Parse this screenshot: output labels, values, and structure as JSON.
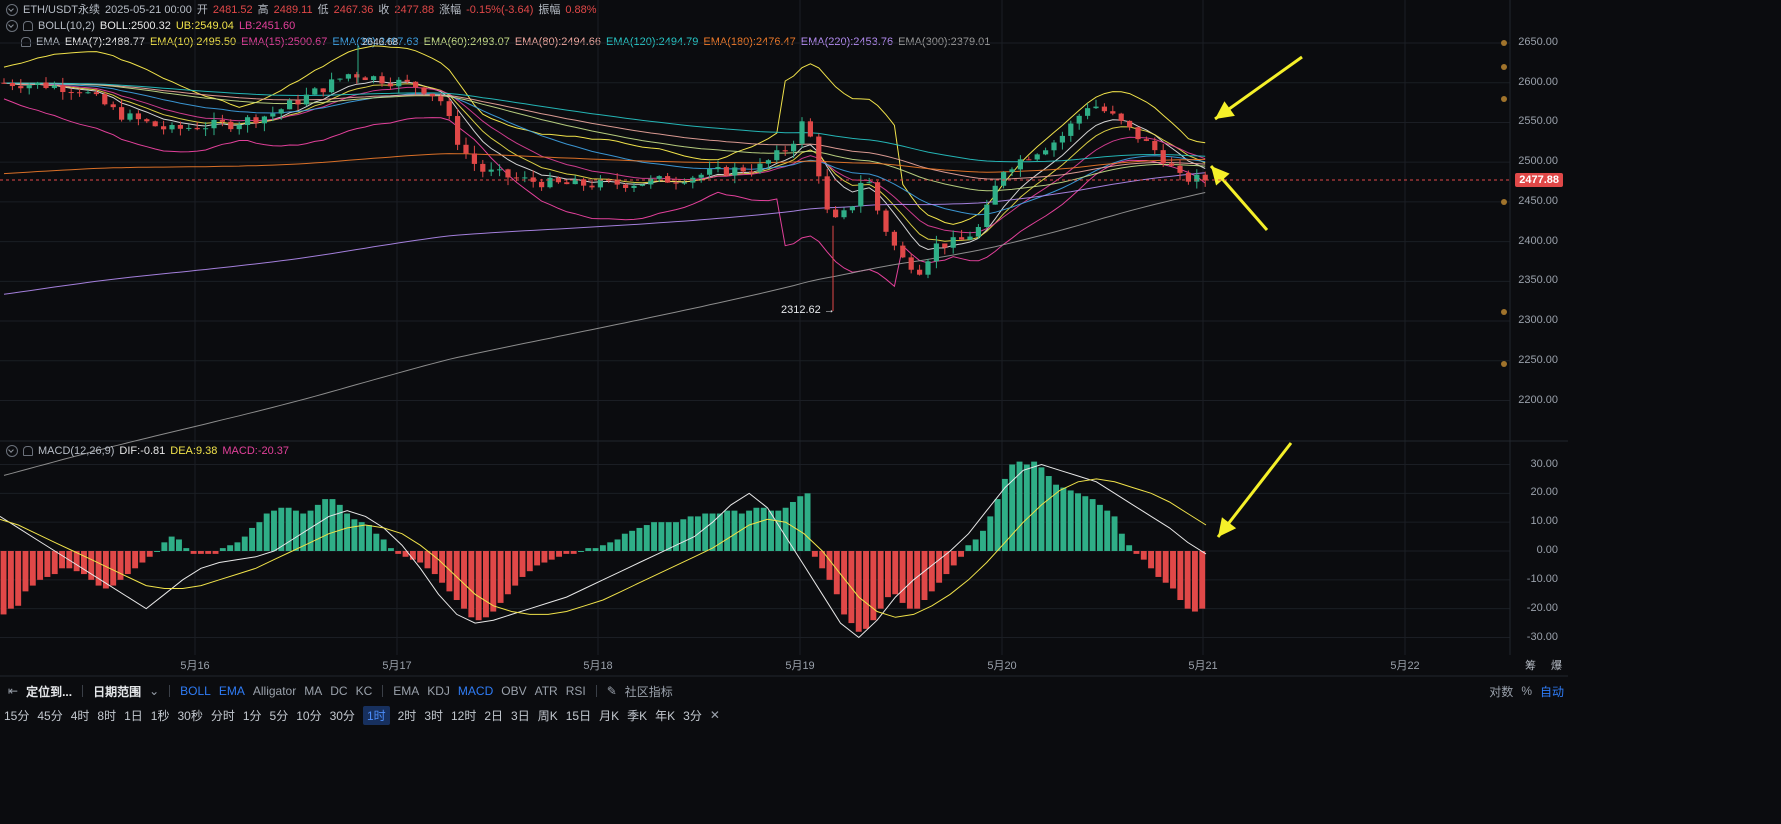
{
  "header": {
    "symbol": "ETH/USDT永续",
    "datetime": "2025-05-21 00:00",
    "open_label": "开",
    "open": "2481.52",
    "high_label": "高",
    "high": "2489.11",
    "low_label": "低",
    "low": "2467.36",
    "close_label": "收",
    "close": "2477.88",
    "change_label": "涨幅",
    "change": "-0.15%(-3.64)",
    "amp_label": "振幅",
    "amp": "0.88%"
  },
  "boll": {
    "name": "BOLL(10,2)",
    "mid": "BOLL:2500.32",
    "ub": "UB:2549.04",
    "lb": "LB:2451.60"
  },
  "ema": {
    "name": "EMA",
    "items": [
      {
        "text": "EMA(7):2488.77",
        "color": "#e8e8e8"
      },
      {
        "text": "EMA(10):2495.50",
        "color": "#f0e24a"
      },
      {
        "text": "EMA(15):2500.67",
        "color": "#e2409a"
      },
      {
        "text": "EMA(30):2497.63",
        "color": "#3fa3e6"
      },
      {
        "text": "EMA(60):2493.07",
        "color": "#c8e08a"
      },
      {
        "text": "EMA(80):2494.66",
        "color": "#f0a8a0"
      },
      {
        "text": "EMA(120):2494.79",
        "color": "#27c6c6"
      },
      {
        "text": "EMA(180):2476.47",
        "color": "#f07a2a"
      },
      {
        "text": "EMA(220):2453.76",
        "color": "#b48cf2"
      },
      {
        "text": "EMA(300):2379.01",
        "color": "#9a9a9a"
      }
    ]
  },
  "macd": {
    "name": "MACD(12,26,9)",
    "dif": "DIF:-0.81",
    "dea": "DEA:9.38",
    "macd": "MACD:-20.37"
  },
  "annotations": {
    "high_label": "2646.68",
    "low_label": "2312.62 →"
  },
  "current_price": "2477.88",
  "toolbar": {
    "locate": "定位到...",
    "date_range": "日期范围",
    "main_indicators": [
      "BOLL",
      "EMA",
      "Alligator",
      "MA",
      "DC",
      "KC"
    ],
    "sub_indicators": [
      "EMA",
      "KDJ",
      "MACD",
      "OBV",
      "ATR",
      "RSI"
    ],
    "community": "社区指标",
    "right": [
      "对数",
      "%",
      "自动"
    ],
    "bottom_right": [
      "筹",
      "爆"
    ]
  },
  "timeframes": [
    "15分",
    "45分",
    "4时",
    "8时",
    "1日",
    "1秒",
    "30秒",
    "分时",
    "1分",
    "5分",
    "10分",
    "30分",
    "1时",
    "2时",
    "3时",
    "12时",
    "2日",
    "3日",
    "周K",
    "15日",
    "月K",
    "季K",
    "年K",
    "3分"
  ],
  "selected_timeframe": "1时",
  "colors": {
    "up": "#2fae87",
    "down": "#e04848",
    "bg": "#0b0c0f",
    "arrow": "#f5f029",
    "accent": "#2f7cf6"
  },
  "chart_data": [
    {
      "type": "candlestick",
      "x_ticks": [
        "5月16",
        "5月17",
        "5月18",
        "5月19",
        "5月20",
        "5月21",
        "5月22"
      ],
      "y_ticks": [
        2200,
        2250,
        2300,
        2350,
        2400,
        2450,
        2500,
        2550,
        2600,
        2650
      ],
      "ylim": [
        2165,
        2680
      ],
      "grid": true,
      "key_points": [
        {
          "label": "start",
          "value": 2600
        },
        {
          "label": "5月16",
          "value": 2545
        },
        {
          "label": "5月16 high",
          "value": 2646.68
        },
        {
          "label": "5月17 late",
          "value": 2470
        },
        {
          "label": "5月18",
          "value": 2478
        },
        {
          "label": "5月19 peak",
          "value": 2560
        },
        {
          "label": "5月19 low",
          "value": 2312.62
        },
        {
          "label": "5月19 late",
          "value": 2360
        },
        {
          "label": "5月20",
          "value": 2490
        },
        {
          "label": "5月20 high",
          "value": 2585
        },
        {
          "label": "last close",
          "value": 2477.88
        }
      ]
    },
    {
      "type": "bar",
      "title": "MACD(12,26,9)",
      "y_ticks": [
        -30,
        -20,
        -10,
        0,
        10,
        20,
        30
      ],
      "ylim": [
        -35,
        35
      ],
      "series": [
        {
          "name": "MACD",
          "values": [
            -22,
            -20,
            -19,
            -14,
            -12,
            -10,
            -9,
            -8,
            -6,
            -6,
            -7,
            -8,
            -10,
            -12,
            -13,
            -12,
            -10,
            -8,
            -6,
            -4,
            -2,
            0,
            3,
            5,
            4,
            1,
            -1,
            -1,
            -1,
            -1,
            1,
            2,
            3,
            5,
            8,
            10,
            13,
            14,
            15,
            15,
            14,
            13,
            14,
            16,
            18,
            18,
            16,
            13,
            11,
            10,
            9,
            6,
            4,
            1,
            -1,
            -2,
            -3,
            -4,
            -6,
            -8,
            -11,
            -14,
            -17,
            -20,
            -23,
            -24,
            -23,
            -21,
            -18,
            -15,
            -12,
            -9,
            -7,
            -5,
            -4,
            -3,
            -2,
            -1,
            -1,
            0,
            1,
            1,
            2,
            3,
            4,
            6,
            7,
            8,
            9,
            10,
            10,
            10,
            10,
            11,
            12,
            12,
            13,
            13,
            13,
            14,
            14,
            13,
            14,
            15,
            15,
            14,
            14,
            15,
            17,
            19,
            20,
            -2,
            -6,
            -10,
            -15,
            -22,
            -25,
            -28,
            -27,
            -24,
            -20,
            -16,
            -15,
            -18,
            -20,
            -20,
            -17,
            -14,
            -11,
            -8,
            -5,
            -2,
            2,
            4,
            7,
            12,
            18,
            25,
            30,
            31,
            30,
            31,
            29,
            26,
            23,
            22,
            21,
            20,
            19,
            18,
            16,
            14,
            12,
            6,
            2,
            -1,
            -3,
            -6,
            -9,
            -11,
            -13,
            -17,
            -20,
            -21,
            -20
          ]
        },
        {
          "name": "DIF",
          "values": [
            12,
            8,
            4,
            0,
            -4,
            -8,
            -12,
            -16,
            -20,
            -15,
            -10,
            -6,
            -4,
            -3,
            -2,
            0,
            4,
            8,
            12,
            14,
            12,
            8,
            2,
            -6,
            -15,
            -22,
            -25,
            -24,
            -22,
            -20,
            -18,
            -16,
            -13,
            -10,
            -7,
            -4,
            -1,
            2,
            5,
            10,
            16,
            20,
            15,
            5,
            -5,
            -15,
            -25,
            -30,
            -24,
            -16,
            -10,
            -5,
            0,
            6,
            14,
            22,
            28,
            30,
            28,
            26,
            24,
            20,
            16,
            12,
            8,
            3,
            -1
          ]
        },
        {
          "name": "DEA",
          "values": [
            11,
            9,
            6,
            3,
            0,
            -3,
            -6,
            -9,
            -12,
            -13,
            -13,
            -12,
            -10,
            -8,
            -6,
            -3,
            0,
            3,
            6,
            8,
            9,
            8,
            6,
            2,
            -3,
            -9,
            -15,
            -19,
            -21,
            -22,
            -22,
            -21,
            -19,
            -17,
            -14,
            -11,
            -8,
            -5,
            -2,
            1,
            5,
            9,
            11,
            10,
            6,
            0,
            -8,
            -16,
            -21,
            -23,
            -22,
            -19,
            -15,
            -10,
            -4,
            3,
            10,
            16,
            21,
            24,
            25,
            24,
            22,
            20,
            17,
            13,
            9
          ]
        }
      ]
    }
  ]
}
